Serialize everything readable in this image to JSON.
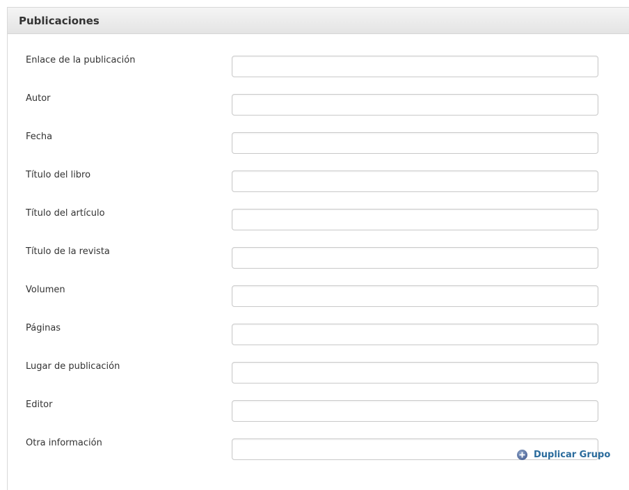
{
  "panel": {
    "title": "Publicaciones"
  },
  "fields": [
    {
      "label": "Enlace de la publicación",
      "value": "",
      "placeholder": ""
    },
    {
      "label": "Autor",
      "value": "",
      "placeholder": ""
    },
    {
      "label": "Fecha",
      "value": "",
      "placeholder": ""
    },
    {
      "label": "Título del libro",
      "value": "",
      "placeholder": ""
    },
    {
      "label": "Título del artículo",
      "value": "",
      "placeholder": ""
    },
    {
      "label": "Título de la revista",
      "value": "",
      "placeholder": ""
    },
    {
      "label": "Volumen",
      "value": "",
      "placeholder": ""
    },
    {
      "label": "Páginas",
      "value": "",
      "placeholder": ""
    },
    {
      "label": "Lugar de publicación",
      "value": "",
      "placeholder": ""
    },
    {
      "label": "Editor",
      "value": "",
      "placeholder": ""
    },
    {
      "label": "Otra información",
      "value": "",
      "placeholder": ""
    }
  ],
  "actions": {
    "duplicate_label": "Duplicar Grupo",
    "duplicate_icon": "plus-circle-icon",
    "link_color": "#2a6b9c"
  }
}
